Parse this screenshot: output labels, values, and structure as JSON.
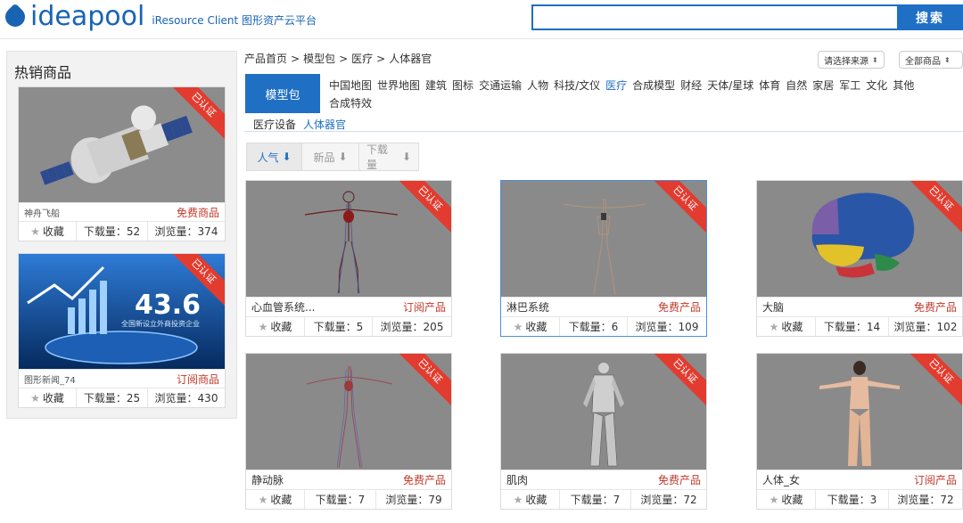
{
  "header": {
    "logo_text": "ideapool",
    "logo_sub": "iResource Client 图形资产云平台",
    "search_placeholder": "",
    "search_button": "搜索"
  },
  "sidebar": {
    "title": "热销商品",
    "items": [
      {
        "name": "神舟飞船",
        "type": "免费商品",
        "fav": "收藏",
        "downloads": "下载量：52",
        "views": "浏览量：374",
        "badge": "已认证"
      },
      {
        "name": "图形新闻_74",
        "type": "订阅商品",
        "fav": "收藏",
        "downloads": "下载量：25",
        "views": "浏览量：430",
        "badge": "已认证",
        "thumb_text": "43.6",
        "thumb_sub": "全国新设立外商投资企业"
      }
    ]
  },
  "breadcrumb": [
    "产品首页",
    ">",
    "模型包",
    ">",
    "医疗",
    ">",
    "人体器官"
  ],
  "filters": {
    "source": "请选择来源",
    "scope": "全部商品"
  },
  "category": {
    "tab": "模型包",
    "items": [
      "中国地图",
      "世界地图",
      "建筑",
      "图标",
      "交通运输",
      "人物",
      "科技/文仪",
      "医疗",
      "合成模型",
      "财经",
      "天体/星球",
      "体育",
      "自然",
      "家居",
      "军工",
      "文化",
      "其他",
      "合成特效"
    ],
    "active": "医疗",
    "sub": [
      "医疗设备",
      "人体器官"
    ],
    "sub_active": "人体器官"
  },
  "sort": [
    {
      "label": "人气",
      "arrow": "⬇",
      "active": true
    },
    {
      "label": "新品",
      "arrow": "⬇",
      "active": false
    },
    {
      "label": "下载量",
      "arrow": "⬇",
      "active": false
    }
  ],
  "products": [
    {
      "name": "心血管系统...",
      "type": "订阅产品",
      "fav": "收藏",
      "downloads": "下载量：5",
      "views": "浏览量：205",
      "badge": "已认证"
    },
    {
      "name": "淋巴系统",
      "type": "免费产品",
      "fav": "收藏",
      "downloads": "下载量：6",
      "views": "浏览量：109",
      "badge": "已认证"
    },
    {
      "name": "大脑",
      "type": "免费产品",
      "fav": "收藏",
      "downloads": "下载量：14",
      "views": "浏览量：102",
      "badge": "已认证"
    },
    {
      "name": "静动脉",
      "type": "免费产品",
      "fav": "收藏",
      "downloads": "下载量：7",
      "views": "浏览量：79",
      "badge": "已认证"
    },
    {
      "name": "肌肉",
      "type": "免费产品",
      "fav": "收藏",
      "downloads": "下载量：7",
      "views": "浏览量：72",
      "badge": "已认证"
    },
    {
      "name": "人体_女",
      "type": "订阅产品",
      "fav": "收藏",
      "downloads": "下载量：3",
      "views": "浏览量：72",
      "badge": "已认证"
    }
  ],
  "colors": {
    "accent": "#1f6fc5",
    "badge": "#e13c2f",
    "price": "#c0392b"
  },
  "icons": {
    "star": "star-icon",
    "sort_arrow": "arrow-down-icon"
  }
}
